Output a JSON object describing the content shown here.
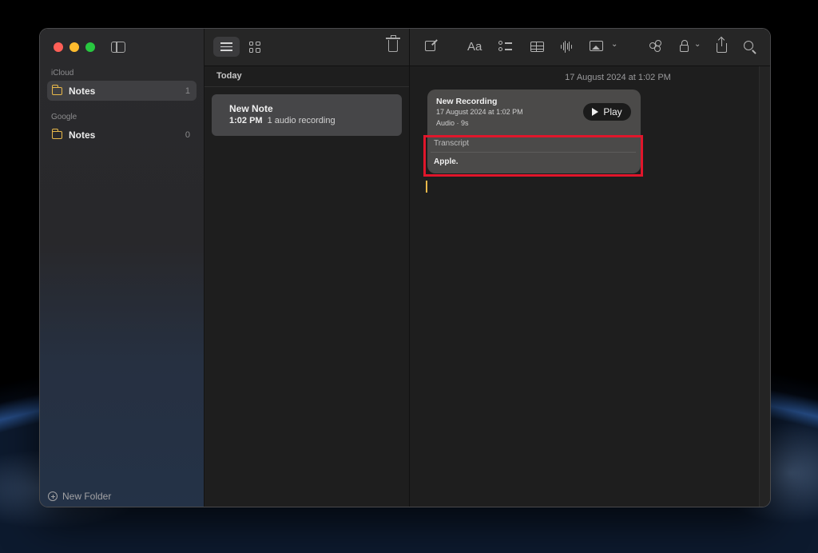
{
  "window": {
    "sidebar": {
      "sections": [
        {
          "label": "iCloud",
          "folders": [
            {
              "name": "Notes",
              "count": "1",
              "selected": true
            }
          ]
        },
        {
          "label": "Google",
          "folders": [
            {
              "name": "Notes",
              "count": "0",
              "selected": false
            }
          ]
        }
      ],
      "new_folder_label": "New Folder"
    },
    "note_list": {
      "group_header": "Today",
      "notes": [
        {
          "title": "New Note",
          "time": "1:02 PM",
          "preview": "1 audio recording",
          "selected": true
        }
      ]
    },
    "editor": {
      "note_date": "17 August 2024 at 1:02 PM",
      "toolbar": {
        "format_label": "Aa"
      },
      "recording": {
        "title": "New Recording",
        "date": "17 August 2024 at 1:02 PM",
        "kind": "Audio · 9s",
        "play_label": "Play"
      },
      "transcript": {
        "label": "Transcript",
        "text": "Apple."
      }
    }
  },
  "colors": {
    "highlight_box": "#e0162b",
    "folder_accent": "#e8b84a",
    "selected_row": "#3f3f42",
    "card": "#4b4a49"
  },
  "icons": [
    "sidebar-toggle-icon",
    "list-view-icon",
    "gallery-view-icon",
    "trash-icon",
    "compose-icon",
    "format-text-icon",
    "checklist-icon",
    "table-icon",
    "audio-waveform-icon",
    "media-icon",
    "collaborate-icon",
    "lock-icon",
    "share-icon",
    "search-icon",
    "folder-icon",
    "plus-circle-icon",
    "play-icon"
  ]
}
